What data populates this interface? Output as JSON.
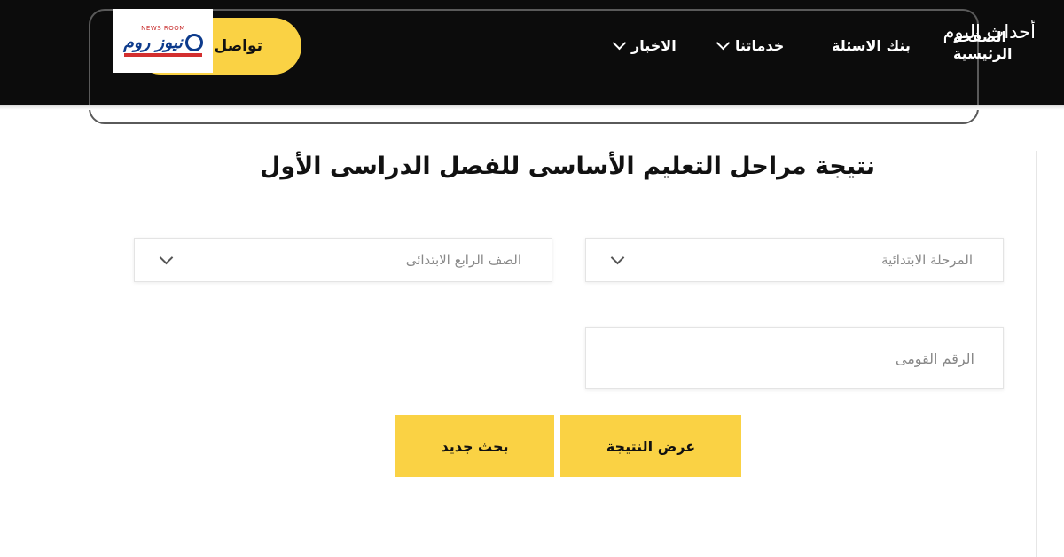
{
  "header": {
    "contact_label": "تواصل",
    "logo": {
      "tagline": "NEWS ROOM",
      "wordmark": "نيوز روم"
    },
    "nav": {
      "news": "الاخبار",
      "services": "خدماتنا",
      "question_bank": "بنك الاسئلة",
      "home": "الصفحة الرئيسية"
    }
  },
  "watermark": "أحداث اليوم",
  "form": {
    "title": "نتيجة مراحل التعليم الأساسى للفصل الدراسى الأول",
    "stage_select": {
      "value": "المرحلة الابتدائية"
    },
    "grade_select": {
      "value": "الصف الرابع الابتدائى"
    },
    "national_id": {
      "placeholder": "الرقم القومى",
      "value": ""
    },
    "show_result_button": "عرض النتيجة",
    "new_search_button": "بحث جديد"
  },
  "colors": {
    "header_bg": "#0c0c0c",
    "accent_yellow": "#fad244",
    "logo_blue": "#0d3b8c",
    "logo_red": "#d32f2f"
  }
}
